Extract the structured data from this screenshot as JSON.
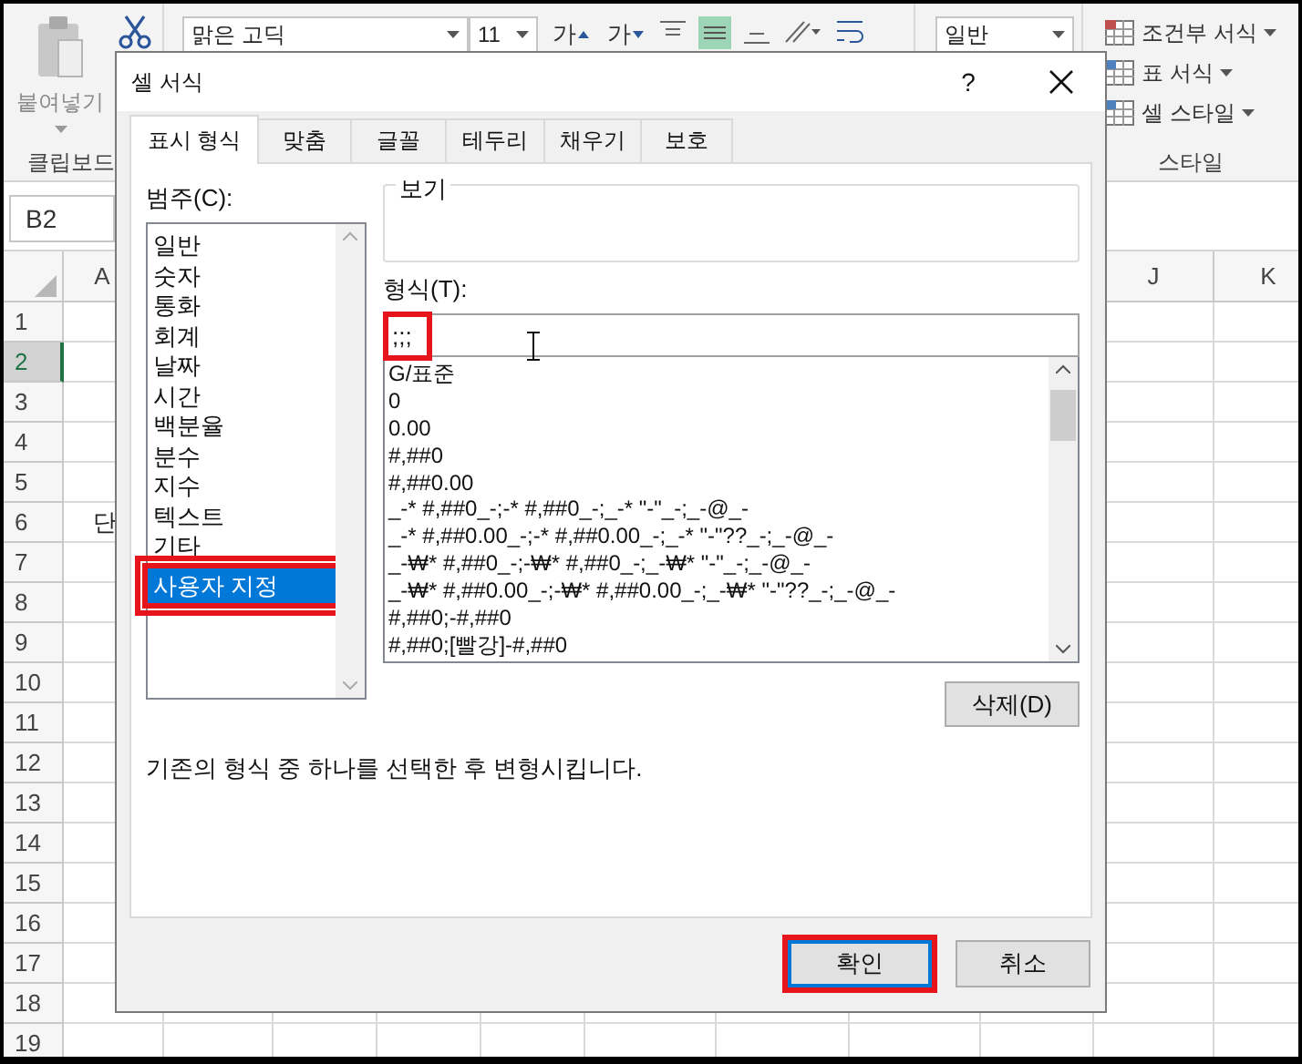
{
  "ribbon": {
    "paste_label": "붙여넣기",
    "clipboard_group": "클립보드",
    "font_name": "맑은 고딕",
    "font_size": "11",
    "font_buttons": [
      "가",
      "가"
    ],
    "number_format": "일반",
    "style_buttons": [
      "조건부 서식",
      "표 서식",
      "셀 스타일"
    ],
    "style_group": "스타일"
  },
  "name_box": "B2",
  "columns": [
    "A",
    "J",
    "K"
  ],
  "rows": [
    {
      "header": "1",
      "selected": false
    },
    {
      "header": "2",
      "selected": true
    },
    {
      "header": "3",
      "selected": false
    },
    {
      "header": "4",
      "selected": false
    },
    {
      "header": "5",
      "selected": false
    },
    {
      "header": "6",
      "selected": false,
      "cells": [
        "단"
      ]
    },
    {
      "header": "7",
      "selected": false
    },
    {
      "header": "8",
      "selected": false
    },
    {
      "header": "9",
      "selected": false
    },
    {
      "header": "10",
      "selected": false
    },
    {
      "header": "11",
      "selected": false
    },
    {
      "header": "12",
      "selected": false
    },
    {
      "header": "13",
      "selected": false
    },
    {
      "header": "14",
      "selected": false
    },
    {
      "header": "15",
      "selected": false
    },
    {
      "header": "16",
      "selected": false
    },
    {
      "header": "17",
      "selected": false
    },
    {
      "header": "18",
      "selected": false
    },
    {
      "header": "19",
      "selected": false
    }
  ],
  "dialog": {
    "title": "셀 서식",
    "help": "?",
    "tabs": [
      {
        "label": "표시 형식",
        "selected": true
      },
      {
        "label": "맞춤",
        "selected": false
      },
      {
        "label": "글꼴",
        "selected": false
      },
      {
        "label": "테두리",
        "selected": false
      },
      {
        "label": "채우기",
        "selected": false
      },
      {
        "label": "보호",
        "selected": false
      }
    ],
    "category_label": "범주(C):",
    "categories": [
      {
        "label": "일반",
        "selected": false,
        "highlighted": false
      },
      {
        "label": "숫자",
        "selected": false,
        "highlighted": false
      },
      {
        "label": "통화",
        "selected": false,
        "highlighted": false
      },
      {
        "label": "회계",
        "selected": false,
        "highlighted": false
      },
      {
        "label": "날짜",
        "selected": false,
        "highlighted": false
      },
      {
        "label": "시간",
        "selected": false,
        "highlighted": false
      },
      {
        "label": "백분율",
        "selected": false,
        "highlighted": false
      },
      {
        "label": "분수",
        "selected": false,
        "highlighted": false
      },
      {
        "label": "지수",
        "selected": false,
        "highlighted": false
      },
      {
        "label": "텍스트",
        "selected": false,
        "highlighted": false
      },
      {
        "label": "기타",
        "selected": false,
        "highlighted": false
      },
      {
        "label": "사용자 지정",
        "selected": true,
        "highlighted": true
      }
    ],
    "preview_label": "보기",
    "type_label": "형식(T):",
    "type_field": {
      "value": ";;;",
      "highlighted": true
    },
    "formats": [
      "G/표준",
      "0",
      "0.00",
      "#,##0",
      "#,##0.00",
      "_-* #,##0_-;-* #,##0_-;_-* \"-\"_-;_-@_-",
      "_-* #,##0.00_-;-* #,##0.00_-;_-* \"-\"??_-;_-@_-",
      "_-₩* #,##0_-;-₩* #,##0_-;_-₩* \"-\"_-;_-@_-",
      "_-₩* #,##0.00_-;-₩* #,##0.00_-;_-₩* \"-\"??_-;_-@_-",
      "#,##0;-#,##0",
      "#,##0;[빨강]-#,##0"
    ],
    "delete_button": "삭제(D)",
    "description": "기존의 형식 중 하나를 선택한 후 변형시킵니다.",
    "buttons": [
      {
        "label": "확인",
        "kind": "ok",
        "highlighted": true
      },
      {
        "label": "취소",
        "kind": "cancel",
        "highlighted": false
      }
    ]
  }
}
